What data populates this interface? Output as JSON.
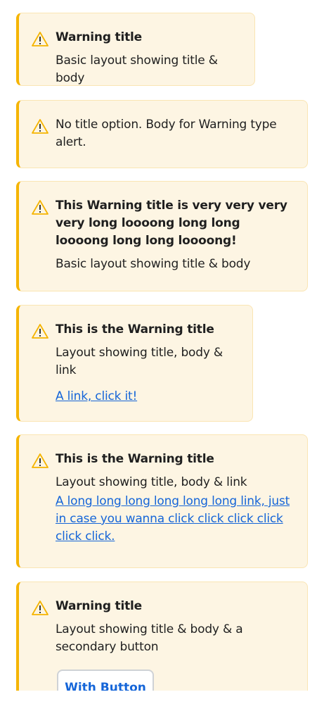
{
  "alerts": [
    {
      "title": "Warning title",
      "body": "Basic layout showing title & body"
    },
    {
      "body": "No title option. Body for Warning type alert."
    },
    {
      "title": "This Warning title is very very very very long loooong long long loooong long long loooong!",
      "body": "Basic layout showing title & body"
    },
    {
      "title": "This is the Warning title",
      "body": "Layout showing title, body & link",
      "link": "A link, click it!"
    },
    {
      "title": "This is the Warning title",
      "body": "Layout showing title, body & link",
      "link": "A long long long long long long link, just in case you wanna click click click click click click."
    },
    {
      "title": "Warning title",
      "body": "Layout showing title & body & a secondary button",
      "button": "With Button"
    }
  ],
  "icons": {
    "warning": "warning-triangle-icon"
  },
  "colors": {
    "background": "#fdf5e3",
    "border": "#fae5b3",
    "accent": "#f5b400",
    "link": "#1565d8"
  }
}
